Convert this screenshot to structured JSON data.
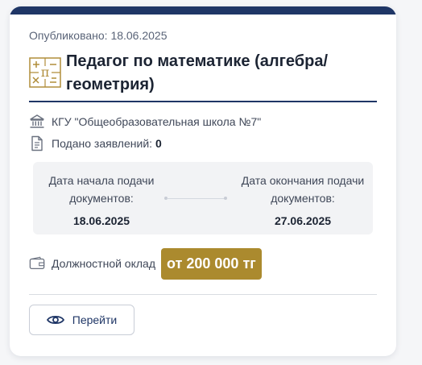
{
  "card": {
    "published": "Опубликовано: 18.06.2025",
    "title": "Педагог по математике (алгебра/ геометрия)",
    "subject_icon": "math-symbols-icon",
    "organization": {
      "icon": "institution-icon",
      "name": "КГУ \"Общеобразовательная школа №7\""
    },
    "applications": {
      "icon": "document-icon",
      "label": "Подано заявлений:",
      "count": "0"
    },
    "dates": {
      "start_label": "Дата начала подачи документов:",
      "start_value": "18.06.2025",
      "end_label": "Дата окончания подачи документов:",
      "end_value": "27.06.2025"
    },
    "salary": {
      "icon": "wallet-icon",
      "label": "Должностной оклад",
      "value": "от 200 000 тг"
    },
    "button": {
      "icon": "eye-icon",
      "label": "Перейти"
    }
  },
  "colors": {
    "brand_navy": "#1f3666",
    "salary_gold": "#ab8a2e",
    "icon_gold": "#b08d3a"
  }
}
